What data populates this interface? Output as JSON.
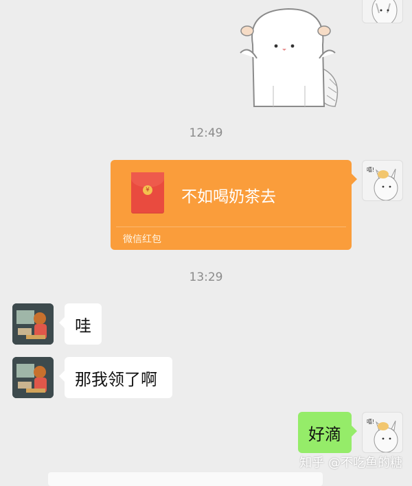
{
  "timestamps": [
    "12:49",
    "13:29"
  ],
  "red_packet": {
    "message": "不如喝奶茶去",
    "source_label": "微信红包",
    "coin_symbol": "¥"
  },
  "messages": [
    {
      "side": "left",
      "text": "哇"
    },
    {
      "side": "left",
      "text": "那我领了啊"
    },
    {
      "side": "right",
      "text": "好滴"
    }
  ],
  "watermark": "知乎 @不吃鱼的糖",
  "colors": {
    "background": "#ededed",
    "red_packet": "#fa9d3b",
    "sent_bubble": "#95ec69",
    "received_bubble": "#ffffff"
  }
}
